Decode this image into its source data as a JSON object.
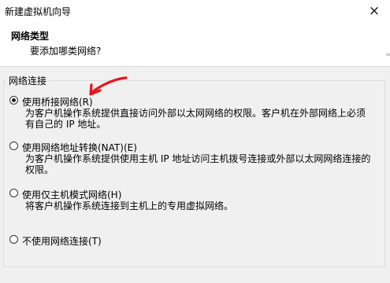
{
  "window": {
    "title": "新建虚拟机向导",
    "close_icon": "×"
  },
  "header": {
    "title": "网络类型",
    "subtitle": "要添加哪类网络?"
  },
  "group": {
    "title": "网络连接"
  },
  "options": [
    {
      "label": "使用桥接网络(R)",
      "checked": true,
      "desc_line1": "为客户机操作系统提供直接访问外部以太网网络的权限。客户机在外部网络上必须",
      "desc_line2": "有自己的 IP 地址。"
    },
    {
      "label": "使用网络地址转换(NAT)(E)",
      "checked": false,
      "desc_line1": "为客户机操作系统提供使用主机 IP 地址访问主机拨号连接或外部以太网网络连接的",
      "desc_line2": "权限。"
    },
    {
      "label": "使用仅主机模式网络(H)",
      "checked": false,
      "desc_line1": "将客户机操作系统连接到主机上的专用虚拟网络。"
    },
    {
      "label": "不使用网络连接(T)",
      "checked": false
    }
  ],
  "annotation": {
    "color": "#e8141c"
  }
}
